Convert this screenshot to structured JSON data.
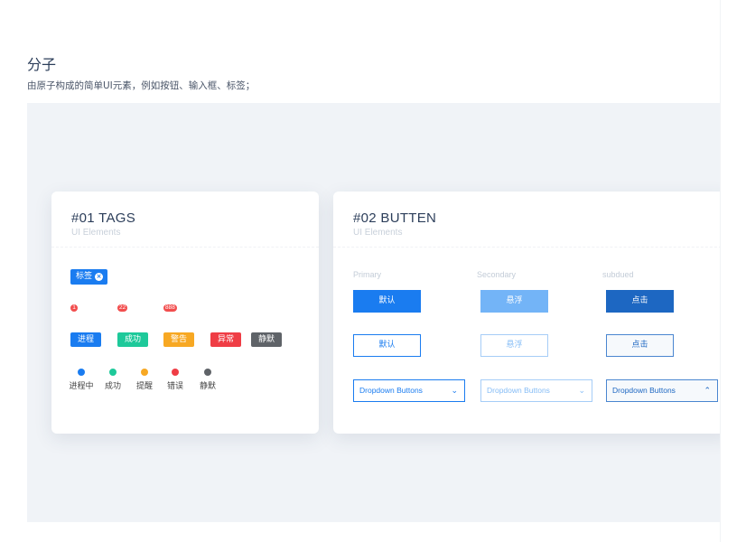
{
  "section": {
    "title": "分子",
    "description": "由原子构成的简单UI元素，例如按钮、输入框、标签；"
  },
  "tags_card": {
    "title": "#01 TAGS",
    "subtitle": "UI Elements",
    "closable_tag": {
      "label": "标签",
      "close_icon": "close-circle-icon",
      "color": "#1a7cf0"
    },
    "badges": [
      "1",
      "22",
      "888"
    ],
    "badge_color": "#f24e4e",
    "status_tags": [
      {
        "label": "进程",
        "color": "#1a7cf0"
      },
      {
        "label": "成功",
        "color": "#1ec99a"
      },
      {
        "label": "警告",
        "color": "#f7a823"
      },
      {
        "label": "异常",
        "color": "#ef3d45"
      },
      {
        "label": "静默",
        "color": "#5f6368"
      }
    ],
    "dot_statuses": [
      {
        "label": "进程中",
        "color": "#1a7cf0"
      },
      {
        "label": "成功",
        "color": "#1ec99a"
      },
      {
        "label": "提醒",
        "color": "#f7a823"
      },
      {
        "label": "错误",
        "color": "#ef3d45"
      },
      {
        "label": "静默",
        "color": "#5f6368"
      }
    ]
  },
  "button_card": {
    "title": "#02 BUTTEN",
    "subtitle": "UI Elements",
    "columns": [
      "Primary",
      "Secondary",
      "subdued"
    ],
    "filled_buttons": [
      "默认",
      "悬浮",
      "点击"
    ],
    "outline_buttons": [
      "默认",
      "悬浮",
      "点击"
    ],
    "dropdowns": [
      {
        "label": "Dropdown Buttons",
        "icon": "chevron-down-icon"
      },
      {
        "label": "Dropdown Buttons",
        "icon": "chevron-down-icon"
      },
      {
        "label": "Dropdown Buttons",
        "icon": "chevron-up-icon"
      }
    ],
    "colors": {
      "primary": "#1a7cf0",
      "secondary": "#73b4f7",
      "subdued": "#1d67c2"
    }
  }
}
